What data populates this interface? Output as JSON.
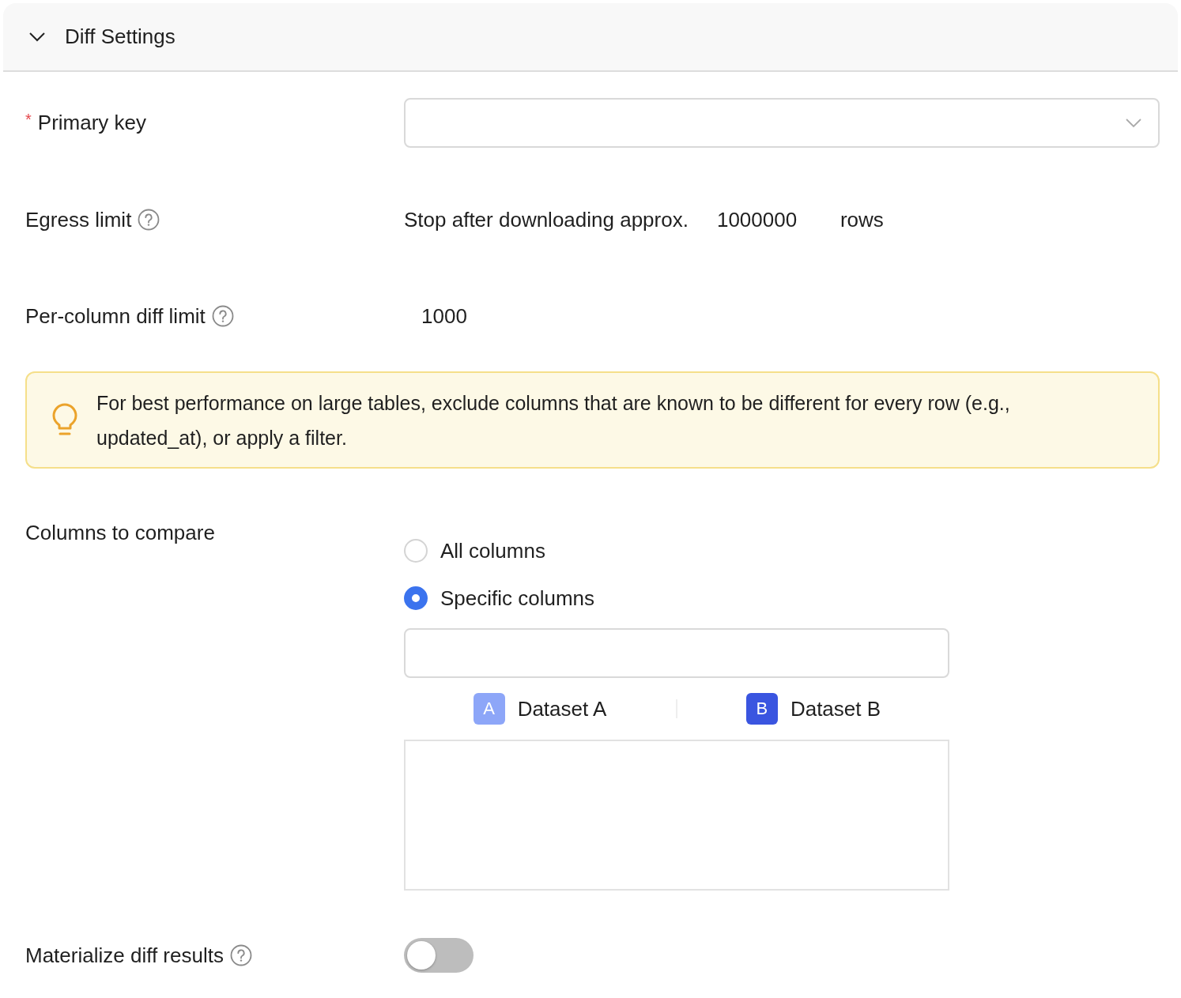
{
  "section": {
    "title": "Diff Settings",
    "expanded": true
  },
  "primary_key": {
    "label": "Primary key",
    "required_mark": "*"
  },
  "egress_limit": {
    "label": "Egress limit",
    "help": true,
    "prefix": "Stop after downloading approx.",
    "value": "1000000",
    "suffix": "rows"
  },
  "per_column_limit": {
    "label": "Per-column diff limit",
    "help": true,
    "value": "1000"
  },
  "tip": {
    "text": "For best performance on large tables, exclude columns that are known to be different for every row (e.g., updated_at), or apply a filter."
  },
  "columns_to_compare": {
    "label": "Columns to compare",
    "options": [
      {
        "label": "All columns",
        "selected": false
      },
      {
        "label": "Specific columns",
        "selected": true
      }
    ],
    "datasets": [
      {
        "badge": "A",
        "name": "Dataset A",
        "color": "#8da6f8"
      },
      {
        "badge": "B",
        "name": "Dataset B",
        "color": "#3a55e0"
      }
    ]
  },
  "materialize": {
    "label": "Materialize diff results",
    "help": true,
    "on": false
  }
}
